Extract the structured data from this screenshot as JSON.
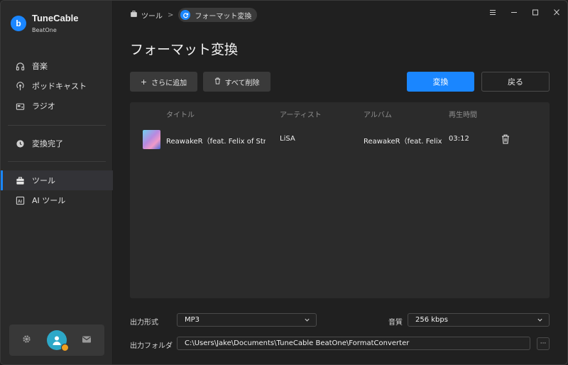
{
  "app": {
    "name": "TuneCable",
    "sub": "BeatOne"
  },
  "sidebar": {
    "items": [
      {
        "label": "音楽"
      },
      {
        "label": "ポッドキャスト"
      },
      {
        "label": "ラジオ"
      },
      {
        "label": "変換完了"
      },
      {
        "label": "ツール"
      },
      {
        "label": "AI ツール"
      }
    ],
    "active": "ツール"
  },
  "breadcrumb": {
    "root": "ツール",
    "sep": ">",
    "current": "フォーマット変換"
  },
  "page": {
    "title": "フォーマット変換"
  },
  "toolbar": {
    "add_label": "さらに追加",
    "delete_all_label": "すべて削除",
    "convert_label": "変換",
    "back_label": "戻る"
  },
  "table": {
    "headers": {
      "title": "タイトル",
      "artist": "アーティスト",
      "album": "アルバム",
      "duration": "再生時間"
    },
    "rows": [
      {
        "title": "ReawakeR（feat. Felix of Stra...",
        "artist": "LiSA",
        "album": "ReawakeR（feat. Felix...",
        "duration": "03:12"
      }
    ]
  },
  "settings": {
    "format_label": "出力形式",
    "format_value": "MP3",
    "quality_label": "音質",
    "quality_value": "256 kbps",
    "folder_label": "出力フォルダ",
    "folder_value": "C:\\Users\\Jake\\Documents\\TuneCable BeatOne\\FormatConverter",
    "more_label": "···"
  },
  "colors": {
    "accent": "#1a86ff",
    "sidebar_bg": "#2a2a2a",
    "main_bg": "#202020",
    "table_bg": "#2b2b2b"
  }
}
